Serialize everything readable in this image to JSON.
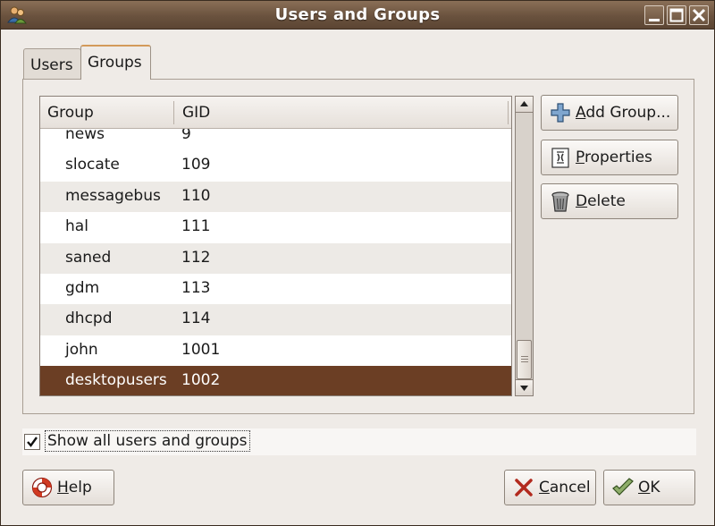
{
  "window": {
    "title": "Users and Groups"
  },
  "tabs": [
    {
      "label": "Users",
      "active": false
    },
    {
      "label": "Groups",
      "active": true
    }
  ],
  "table": {
    "columns": [
      "Group",
      "GID"
    ],
    "rows": [
      {
        "name": "news",
        "gid": "9"
      },
      {
        "name": "slocate",
        "gid": "109"
      },
      {
        "name": "messagebus",
        "gid": "110"
      },
      {
        "name": "hal",
        "gid": "111"
      },
      {
        "name": "saned",
        "gid": "112"
      },
      {
        "name": "gdm",
        "gid": "113"
      },
      {
        "name": "dhcpd",
        "gid": "114"
      },
      {
        "name": "john",
        "gid": "1001"
      },
      {
        "name": "desktopusers",
        "gid": "1002",
        "selected": true
      }
    ]
  },
  "actions": {
    "add_group": {
      "mnemonic": "A",
      "rest": "dd Group..."
    },
    "properties": {
      "mnemonic": "P",
      "rest": "roperties"
    },
    "delete": {
      "mnemonic": "D",
      "rest": "elete"
    }
  },
  "show_all": {
    "label": "Show all users and groups",
    "checked": true
  },
  "footer": {
    "help": {
      "mnemonic": "H",
      "rest": "elp"
    },
    "cancel": {
      "mnemonic": "C",
      "rest": "ancel"
    },
    "ok": {
      "mnemonic": "O",
      "rest": "K"
    }
  },
  "colors": {
    "titlebar": "#6a523e",
    "selection": "#6b3e24",
    "background": "#efebe7"
  },
  "icons": [
    "users-groups-app-icon",
    "minimize-icon",
    "maximize-icon",
    "close-icon",
    "add-icon",
    "properties-icon",
    "trash-icon",
    "help-lifebuoy-icon",
    "cancel-x-icon",
    "ok-check-icon",
    "checkmark-icon"
  ]
}
